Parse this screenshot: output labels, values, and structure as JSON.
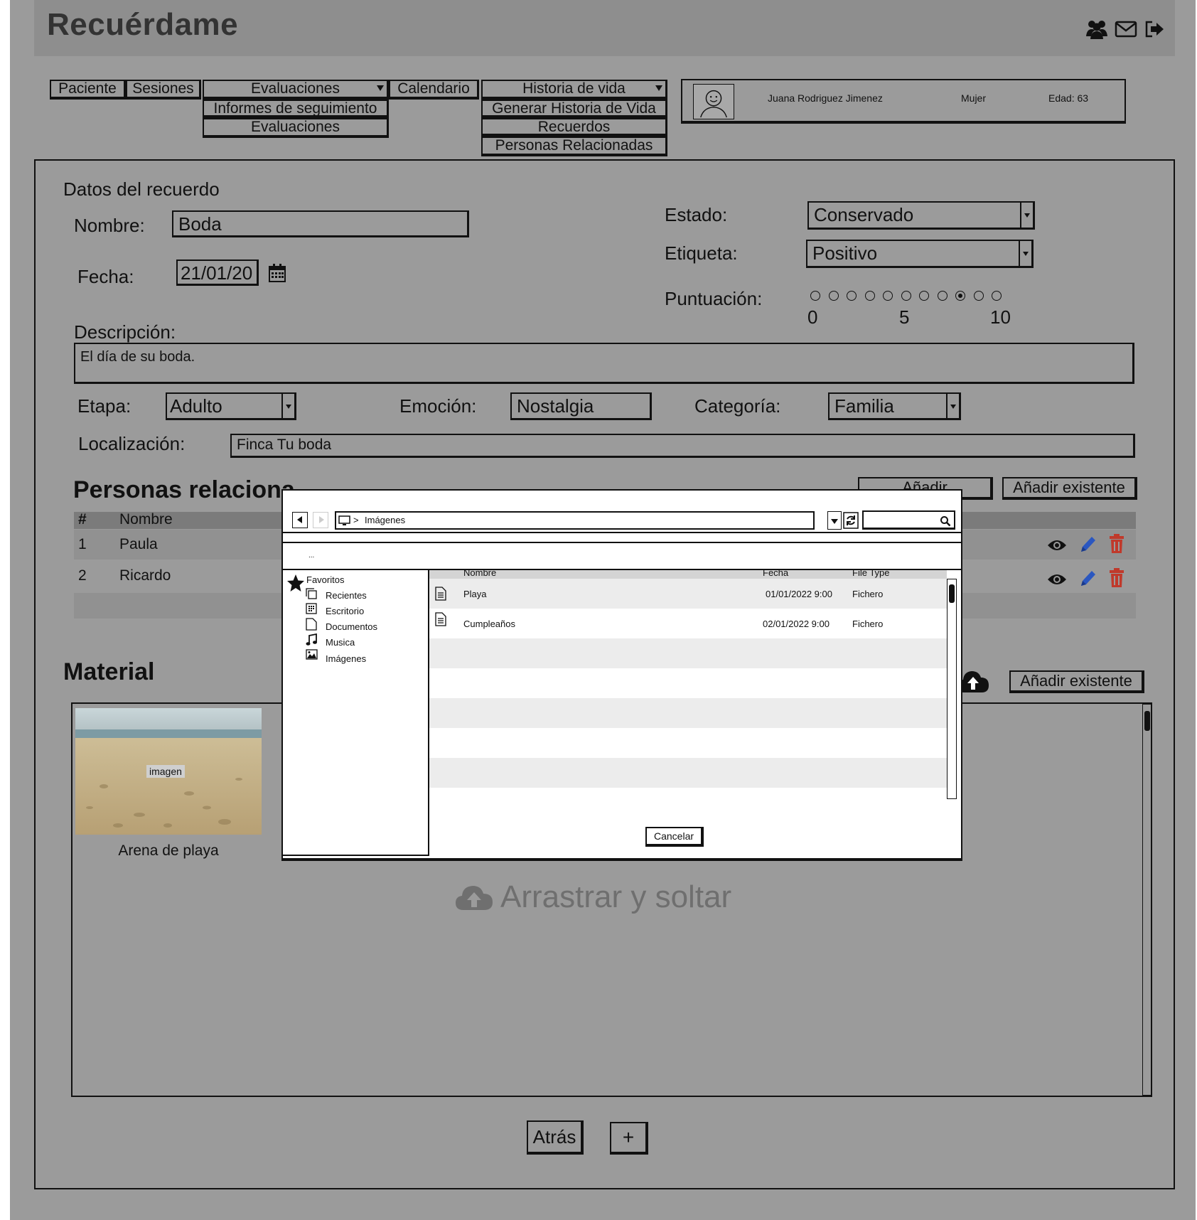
{
  "app": {
    "title": "Recuérdame",
    "header_icons": [
      "users-icon",
      "mail-icon",
      "logout-icon"
    ]
  },
  "nav": {
    "paciente": "Paciente",
    "sesiones": "Sesiones",
    "evaluaciones": "Evaluaciones",
    "evaluaciones_menu": [
      "Informes de seguimiento",
      "Evaluaciones"
    ],
    "calendario": "Calendario",
    "historia": "Historia de vida",
    "historia_menu": [
      "Generar Historia de Vida",
      "Recuerdos",
      "Personas Relacionadas"
    ]
  },
  "patient": {
    "name": "Juana Rodriguez Jimenez",
    "gender": "Mujer",
    "age": "Edad: 63"
  },
  "form": {
    "section_title": "Datos del recuerdo",
    "nombre_label": "Nombre:",
    "nombre_value": "Boda",
    "fecha_label": "Fecha:",
    "fecha_value": "21/01/20",
    "estado_label": "Estado:",
    "estado_value": "Conservado",
    "etiqueta_label": "Etiqueta:",
    "etiqueta_value": "Positivo",
    "puntuacion_label": "Puntuación:",
    "puntuacion_selected": 8,
    "puntuacion_ticks": [
      "0",
      "5",
      "10"
    ],
    "descripcion_label": "Descripción:",
    "descripcion_value": "El día de su boda.",
    "etapa_label": "Etapa:",
    "etapa_value": "Adulto",
    "emocion_label": "Emoción:",
    "emocion_value": "Nostalgia",
    "categoria_label": "Categoría:",
    "categoria_value": "Familia",
    "localizacion_label": "Localización:",
    "localizacion_value": "Finca Tu boda"
  },
  "personas": {
    "title": "Personas relaciona",
    "add_label": "Añadir",
    "add_existing_label": "Añadir existente",
    "columns": [
      "#",
      "Nombre"
    ],
    "rows": [
      {
        "num": "1",
        "name": "Paula"
      },
      {
        "num": "2",
        "name": "Ricardo"
      }
    ]
  },
  "material": {
    "title": "Material",
    "add_existing_label": "Añadir existente",
    "item_tag": "imagen",
    "item_caption": "Arena de playa",
    "dropzone_label": "Arrastrar y soltar"
  },
  "footer": {
    "back_label": "Atrás",
    "plus_label": "+"
  },
  "file_dialog": {
    "path": "Imágenes",
    "ellipsis": "...",
    "sidebar": {
      "favorites": "Favoritos",
      "items": [
        "Recientes",
        "Escritorio",
        "Documentos",
        "Musica",
        "Imágenes"
      ]
    },
    "columns": [
      "Nombre",
      "Fecha",
      "File Type"
    ],
    "files": [
      {
        "name": "Playa",
        "date": "01/01/2022  9:00",
        "type": "Fichero"
      },
      {
        "name": "Cumpleaños",
        "date": "02/01/2022  9:00",
        "type": "Fichero"
      }
    ],
    "cancel_label": "Cancelar"
  }
}
